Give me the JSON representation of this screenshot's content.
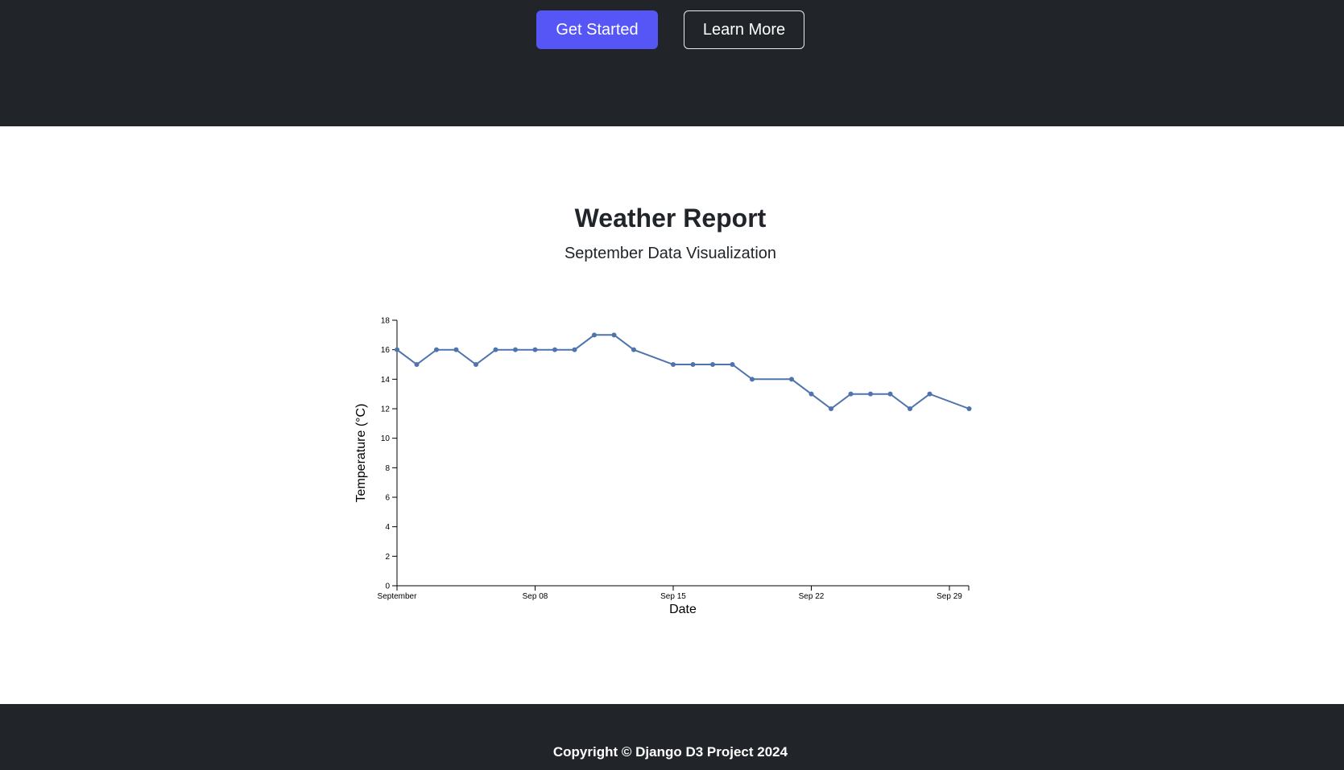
{
  "hero": {
    "get_started_label": "Get Started",
    "learn_more_label": "Learn More"
  },
  "section": {
    "title": "Weather Report",
    "subtitle": "September Data Visualization"
  },
  "colors": {
    "primary_button": "#5656f7",
    "dark_background": "#212529",
    "line": "#4e73ad"
  },
  "chart_data": {
    "type": "line",
    "title": "",
    "xlabel": "Date",
    "ylabel": "Temperature (°C)",
    "ylim": [
      0,
      18
    ],
    "yticks": [
      0,
      2,
      4,
      6,
      8,
      10,
      12,
      14,
      16,
      18
    ],
    "xlim": [
      "2024-09-01",
      "2024-09-30"
    ],
    "xticks": [
      {
        "date": "2024-09-01",
        "label": "September"
      },
      {
        "date": "2024-09-08",
        "label": "Sep 08"
      },
      {
        "date": "2024-09-15",
        "label": "Sep 15"
      },
      {
        "date": "2024-09-22",
        "label": "Sep 22"
      },
      {
        "date": "2024-09-29",
        "label": "Sep 29"
      }
    ],
    "series": [
      {
        "points": [
          {
            "x": "2024-09-01",
            "y": 16
          },
          {
            "x": "2024-09-02",
            "y": 15
          },
          {
            "x": "2024-09-03",
            "y": 16
          },
          {
            "x": "2024-09-04",
            "y": 16
          },
          {
            "x": "2024-09-05",
            "y": 15
          },
          {
            "x": "2024-09-06",
            "y": 16
          },
          {
            "x": "2024-09-07",
            "y": 16
          },
          {
            "x": "2024-09-08",
            "y": 16
          },
          {
            "x": "2024-09-09",
            "y": 16
          },
          {
            "x": "2024-09-10",
            "y": 16
          },
          {
            "x": "2024-09-11",
            "y": 17
          },
          {
            "x": "2024-09-12",
            "y": 17
          },
          {
            "x": "2024-09-13",
            "y": 16
          },
          {
            "x": "2024-09-15",
            "y": 15
          },
          {
            "x": "2024-09-16",
            "y": 15
          },
          {
            "x": "2024-09-17",
            "y": 15
          },
          {
            "x": "2024-09-18",
            "y": 15
          },
          {
            "x": "2024-09-19",
            "y": 14
          },
          {
            "x": "2024-09-21",
            "y": 14
          },
          {
            "x": "2024-09-22",
            "y": 13
          },
          {
            "x": "2024-09-23",
            "y": 12
          },
          {
            "x": "2024-09-24",
            "y": 13
          },
          {
            "x": "2024-09-25",
            "y": 13
          },
          {
            "x": "2024-09-26",
            "y": 13
          },
          {
            "x": "2024-09-27",
            "y": 12
          },
          {
            "x": "2024-09-28",
            "y": 13
          },
          {
            "x": "2024-09-30",
            "y": 12
          }
        ]
      }
    ]
  },
  "footer": {
    "copyright": "Copyright © Django D3 Project 2024"
  }
}
